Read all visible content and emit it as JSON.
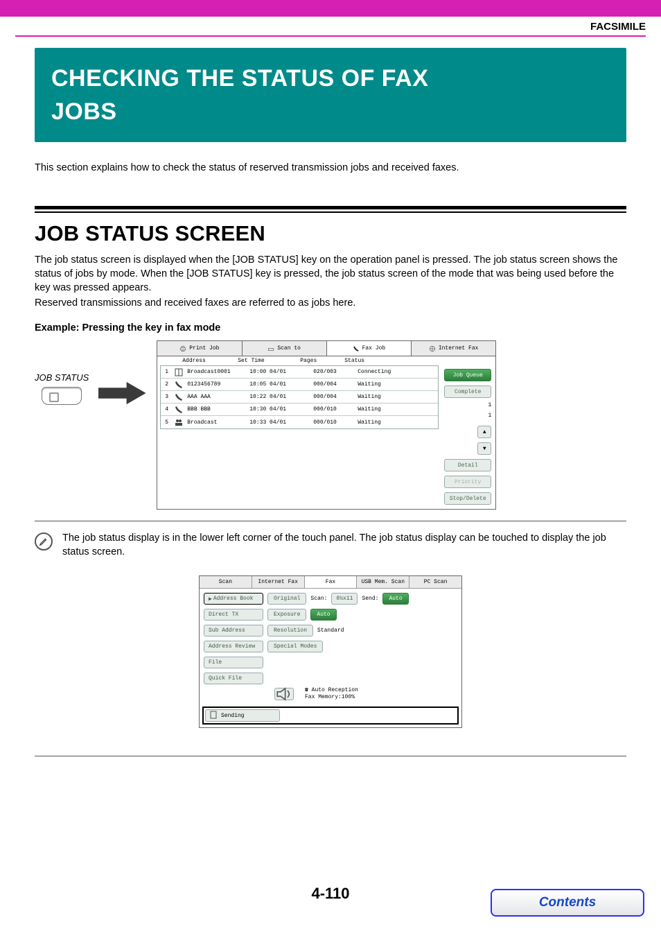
{
  "topnav": {
    "section": "FACSIMILE"
  },
  "h1": {
    "line1": "CHECKING THE STATUS OF FAX",
    "line2": "JOBS"
  },
  "intro": "This section explains how to check the status of reserved transmission jobs and received faxes.",
  "h2": "JOB STATUS SCREEN",
  "body": {
    "p1": "The job status screen is displayed when the [JOB STATUS] key on the operation panel is pressed. The job status screen shows the status of jobs by mode. When the [JOB STATUS] key is pressed, the job status screen of the mode that was being used before the key was pressed appears.",
    "p2": "Reserved transmissions and received faxes are referred to as jobs here."
  },
  "example_label": "Example: Pressing the key in fax mode",
  "jobstatus_key": "JOB STATUS",
  "status_panel": {
    "tabs": [
      "Print Job",
      "Scan to",
      "Fax Job",
      "Internet Fax"
    ],
    "head": {
      "address": "Address",
      "set_time": "Set Time",
      "pages": "Pages",
      "status": "Status"
    },
    "rows": [
      {
        "ix": "1",
        "icon": "book",
        "addr": "Broadcast0001",
        "time": "10:00 04/01",
        "pages": "020/003",
        "status": "Connecting"
      },
      {
        "ix": "2",
        "icon": "phone",
        "addr": "0123456789",
        "time": "10:05 04/01",
        "pages": "000/004",
        "status": "Waiting"
      },
      {
        "ix": "3",
        "icon": "phone",
        "addr": "AAA AAA",
        "time": "10:22 04/01",
        "pages": "000/004",
        "status": "Waiting"
      },
      {
        "ix": "4",
        "icon": "phone",
        "addr": "BBB BBB",
        "time": "10:30 04/01",
        "pages": "000/010",
        "status": "Waiting"
      },
      {
        "ix": "5",
        "icon": "group",
        "addr": "Broadcast",
        "time": "10:33 04/01",
        "pages": "000/010",
        "status": "Waiting"
      }
    ],
    "side": {
      "job_queue": "Job Queue",
      "complete": "Complete",
      "pg1": "1",
      "pg2": "1",
      "detail": "Detail",
      "priority": "Priority",
      "stop": "Stop/Delete",
      "scroll_up": "▲",
      "scroll_down": "▼"
    }
  },
  "note": "The job status display is in the lower left corner of the touch panel. The job status display can be touched to display the job status screen.",
  "fax_panel": {
    "tabs": [
      "Scan",
      "Internet Fax",
      "Fax",
      "USB Mem. Scan",
      "PC Scan"
    ],
    "left": [
      "Address Book",
      "Direct TX",
      "Sub Address",
      "Address Review",
      "File",
      "Quick File"
    ],
    "rows": {
      "original": "Original",
      "scan_lbl": "Scan:",
      "scan_val": "8½x11",
      "send_lbl": "Send:",
      "send_val": "Auto",
      "exposure": "Exposure",
      "exposure_val": "Auto",
      "resolution": "Resolution",
      "resolution_val": "Standard",
      "special": "Special Modes"
    },
    "hook": {
      "auto": "Auto Reception",
      "mem": "Fax Memory:100%"
    },
    "sending": "Sending"
  },
  "page_num": "4-110",
  "contents": "Contents"
}
